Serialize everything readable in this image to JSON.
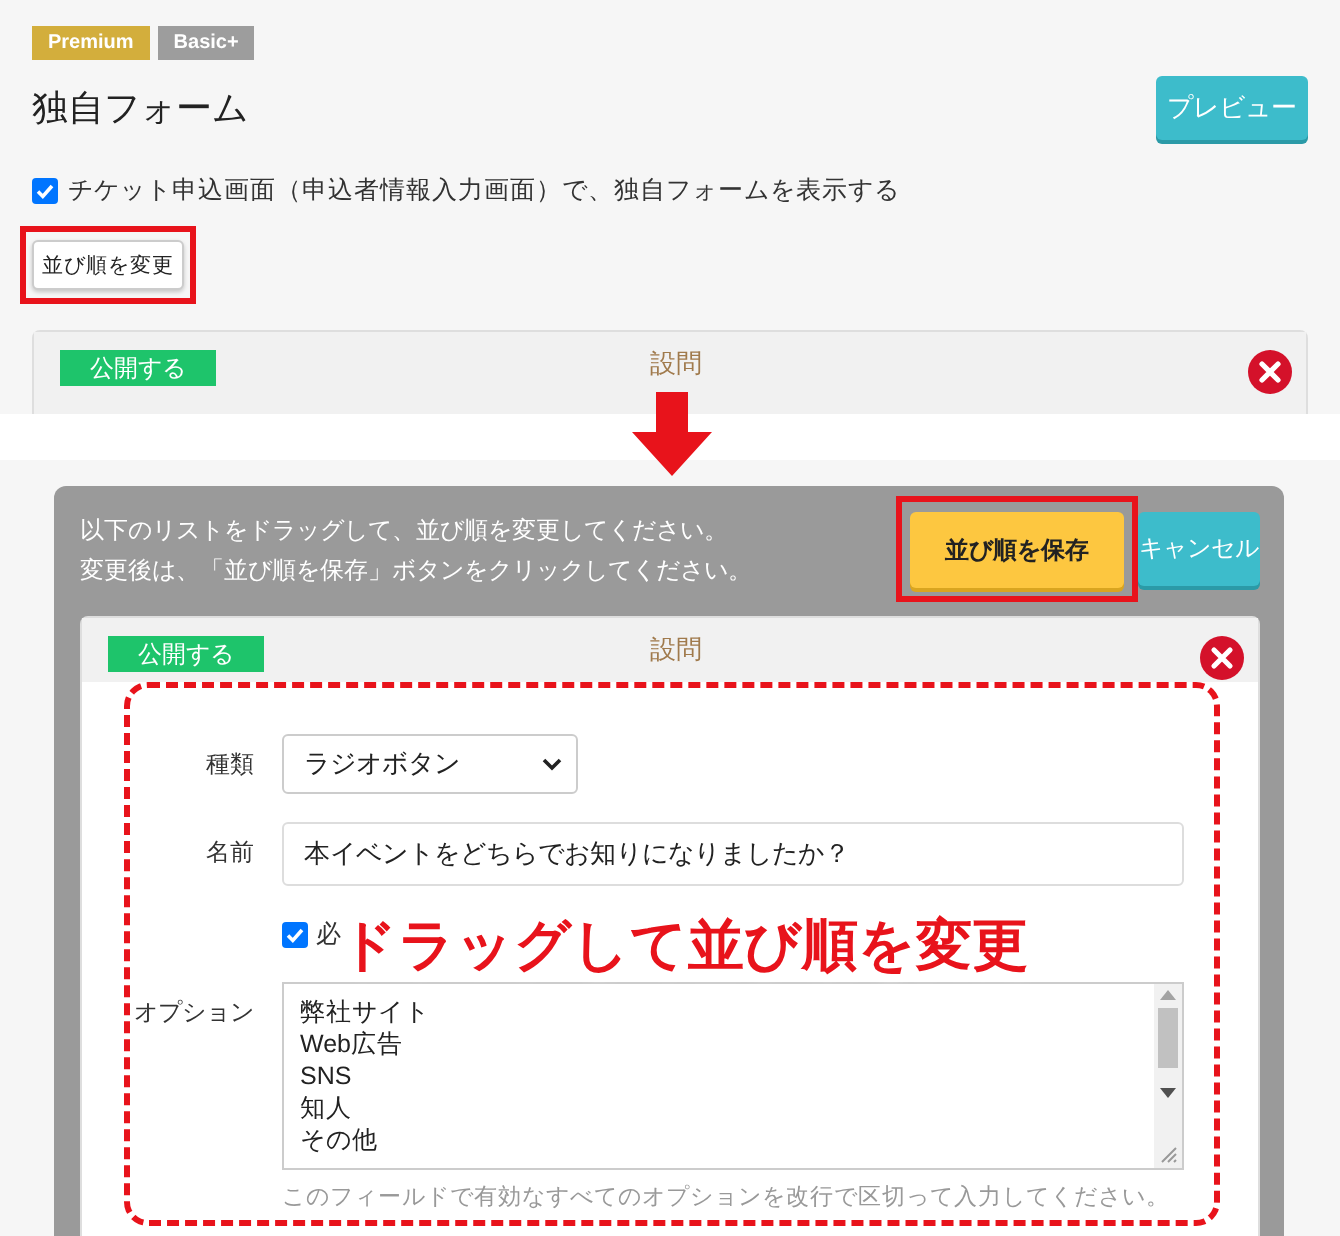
{
  "top": {
    "badges": [
      {
        "label": "Premium",
        "color": "#d3ae3c"
      },
      {
        "label": "Basic+",
        "color": "#9d9d9d"
      }
    ],
    "title": "独自フォーム",
    "preview_button": "プレビュー",
    "show_form_checkbox": {
      "label": "チケット申込画面（申込者情報入力画面）で、独自フォームを表示する",
      "checked": true
    },
    "reorder_button": {
      "label": "並び順を変更",
      "highlighted": true
    },
    "question_card": {
      "publish_label": "公開する",
      "heading": "設問"
    }
  },
  "reorder_panel": {
    "instructions": [
      "以下のリストをドラッグして、並び順を変更してください。",
      "変更後は、「並び順を保存」ボタンをクリックしてください。"
    ],
    "buttons": [
      {
        "kind": "save",
        "label": "並び順を保存",
        "highlighted": true
      },
      {
        "kind": "cancel",
        "label": "キャンセル",
        "highlighted": false
      }
    ],
    "question_card": {
      "publish_label": "公開する",
      "heading": "設問",
      "fields": [
        {
          "kind": "select",
          "label": "種類",
          "value": "ラジオボタン"
        },
        {
          "kind": "text",
          "label": "名前",
          "value": "本イベントをどちらでお知りになりましたか？"
        },
        {
          "kind": "checkbox",
          "label": "必",
          "checked": true
        },
        {
          "kind": "textarea",
          "label": "オプション",
          "lines": [
            "弊社サイト",
            "Web広告",
            "SNS",
            "知人",
            "その他"
          ],
          "hint": "このフィールドで有効なすべてのオプションを改行で区切って入力してください。"
        }
      ]
    },
    "drag_hint": "ドラッグして並び順を変更"
  }
}
